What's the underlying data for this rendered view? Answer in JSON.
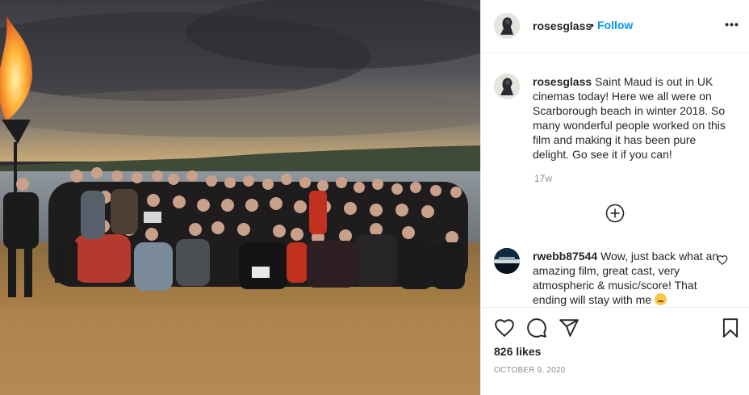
{
  "post": {
    "username": "rosesglass",
    "follow_label": "Follow",
    "dot": "•",
    "more_label": "•••"
  },
  "caption": {
    "username": "rosesglass",
    "text": "Saint Maud is out in UK cinemas today! Here we all were on Scarborough beach in winter 2018. So many wonderful people worked on this film and making it has been pure delight. Go see it if you can!",
    "time": "17w"
  },
  "comments": [
    {
      "username": "rwebb87544",
      "text": "Wow, just back what an amazing film, great cast, very atmospheric & music/score! That ending will stay with me"
    }
  ],
  "actions": {
    "likes": "826 likes",
    "date": "October 9, 2020"
  },
  "icons": {
    "like": "heart-icon",
    "comment": "comment-icon",
    "share": "paper-plane-icon",
    "save": "bookmark-icon",
    "load_more": "plus-circle-icon",
    "options": "more-options-icon"
  },
  "colors": {
    "follow": "#0095f6",
    "text": "#262626",
    "secondary": "#8e8e8e",
    "divider": "#efefef"
  }
}
